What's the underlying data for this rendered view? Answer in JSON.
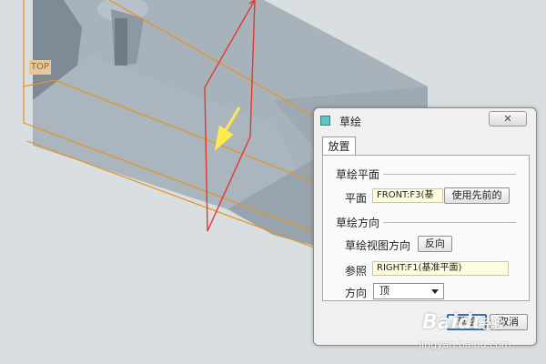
{
  "viewport": {
    "view_label": "TOP",
    "colors": {
      "part": "#a3aeb7",
      "datum_plane": "#e3372f",
      "datum_outline": "#e8931e",
      "direction_arrow": "#ffea4d"
    }
  },
  "dialog": {
    "title": "草绘",
    "close_label": "✕",
    "tab_label": "放置",
    "sketch_plane_section": "草绘平面",
    "plane_label": "平面",
    "plane_value": "FRONT:F3(基",
    "use_previous_label": "使用先前的",
    "sketch_orientation_section": "草绘方向",
    "view_direction_label": "草绘视图方向",
    "flip_label": "反向",
    "reference_label": "参照",
    "reference_value": "RIGHT:F1(基准平面)",
    "orientation_label": "方向",
    "orientation_value": "顶",
    "ok_label": "草绘",
    "cancel_label": "取消"
  },
  "watermark": {
    "brand": "Baidu",
    "brand_suffix": "经验",
    "url": "jingyan.baidu.com"
  }
}
